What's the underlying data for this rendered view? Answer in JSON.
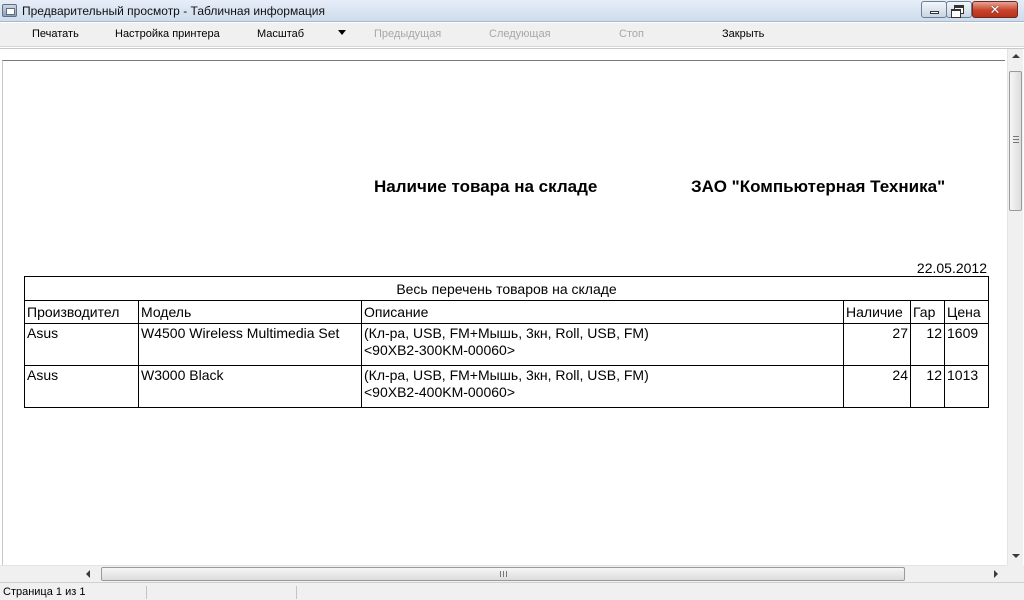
{
  "window": {
    "title": "Предварительный просмотр - Табличная информация"
  },
  "toolbar": {
    "print": "Печатать",
    "printer_setup": "Настройка принтера",
    "scale": "Масштаб",
    "previous": "Предыдущая",
    "next": "Следующая",
    "stop": "Стоп",
    "close": "Закрыть"
  },
  "report": {
    "title": "Наличие товара на складе",
    "company": "ЗАО \"Компьютерная Техника\"",
    "date": "22.05.2012",
    "table_caption": "Весь перечень товаров на складе",
    "columns": [
      "Производител",
      "Модель",
      "Описание",
      "Наличие",
      "Гар",
      "Цена"
    ],
    "rows": [
      {
        "manufacturer": "Asus",
        "model": "W4500 Wireless Multimedia Set",
        "description_line1": "(Кл-ра, USB, FM+Мышь, 3кн, Roll, USB, FM)",
        "description_line2": "<90XB2-300KM-00060>",
        "stock": "27",
        "warranty": "12",
        "price": "1609"
      },
      {
        "manufacturer": "Asus",
        "model": "W3000 Black",
        "description_line1": "(Кл-ра, USB, FM+Мышь, 3кн, Roll, USB, FM)",
        "description_line2": "<90XB2-400KM-00060>",
        "stock": "24",
        "warranty": "12",
        "price": "1013"
      }
    ]
  },
  "statusbar": {
    "page_info": "Страница 1 из 1"
  },
  "icons": {
    "app": "preview-window-icon",
    "minimize": "minimize-icon",
    "maximize": "restore-icon",
    "close": "close-icon",
    "scale_dropdown": "chevron-down-icon"
  },
  "colors": {
    "disabled_text": "#a7a7a7",
    "close_button": "#c7432a"
  }
}
